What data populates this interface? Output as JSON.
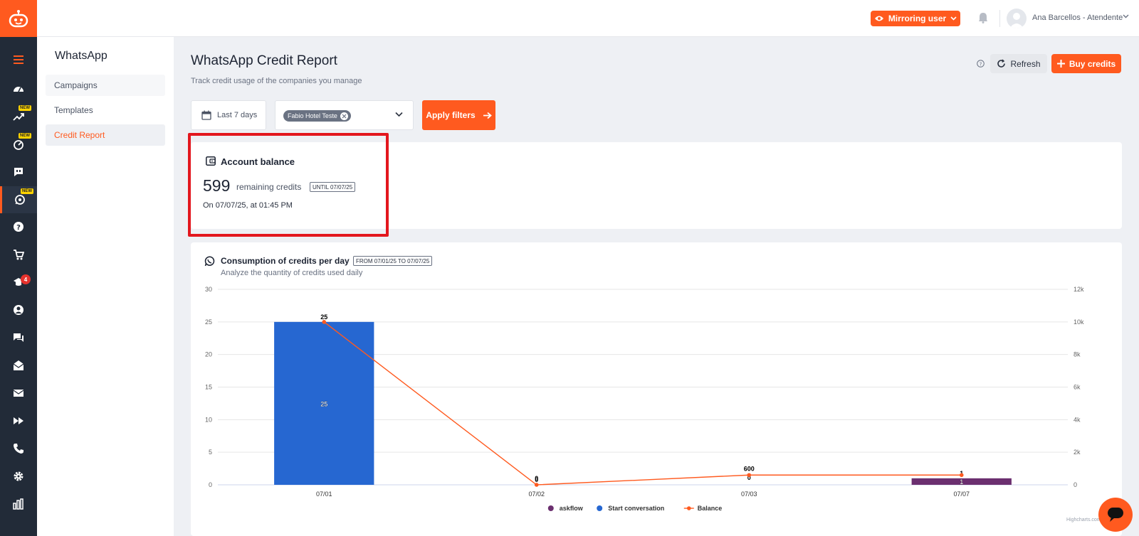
{
  "colors": {
    "accent": "#ff5a1f",
    "rail": "#222b38",
    "highlight": "#e3171e",
    "bar_blue": "#2667d1",
    "bar_purple": "#6b2f6f",
    "balance_line": "#ff5a1f"
  },
  "rail": {
    "icons": [
      "menu-icon",
      "dashboard-icon",
      "trending-icon",
      "rocket-icon",
      "chat-quote-icon",
      "whatsapp-icon",
      "help-icon",
      "cart-icon",
      "graduation-icon",
      "user-circle-icon",
      "chat-icon",
      "mail-open-icon",
      "mail-icon",
      "fast-forward-icon",
      "phone-icon",
      "gear-icon",
      "bar-chart-icon"
    ],
    "new_badge": "NEW",
    "graduation_count": "4"
  },
  "topbar": {
    "mirror_label": "Mirroring user",
    "user_name": "Ana Barcellos - Atendente"
  },
  "sidebar": {
    "title": "WhatsApp",
    "items": [
      {
        "label": "Campaigns"
      },
      {
        "label": "Templates"
      },
      {
        "label": "Credit Report"
      }
    ]
  },
  "main": {
    "title": "WhatsApp Credit Report",
    "subtitle": "Track credit usage of the companies you manage",
    "refresh_label": "Refresh",
    "buy_label": "Buy credits",
    "filters": {
      "date_label": "Last 7 days",
      "company_chip": "Fabio Hotel Teste",
      "apply_label": "Apply filters"
    },
    "balance": {
      "title": "Account balance",
      "value": "599",
      "unit_label": "remaining credits",
      "until_tag": "UNTIL 07/07/25",
      "as_of": "On 07/07/25, at 01:45 PM"
    },
    "chart_card": {
      "title": "Consumption of credits per day",
      "range_tag": "FROM 07/01/25 TO 07/07/25",
      "subtitle": "Analyze the quantity of credits used daily",
      "credits": "Highcharts.com"
    }
  },
  "chart_data": {
    "type": "bar",
    "categories": [
      "07/01",
      "07/02",
      "07/03",
      "07/07"
    ],
    "series": [
      {
        "name": "askflow",
        "type": "bar",
        "axis": "left",
        "color": "#6b2f6f",
        "values": [
          0,
          0,
          0,
          1
        ]
      },
      {
        "name": "Start conversation",
        "type": "bar",
        "axis": "left",
        "color": "#2667d1",
        "values": [
          25,
          0,
          0,
          0
        ]
      },
      {
        "name": "Balance",
        "type": "line",
        "axis": "right",
        "color": "#ff5a1f",
        "values": [
          10000,
          0,
          600,
          600
        ]
      }
    ],
    "stack_totals": [
      "25",
      "0",
      "0",
      "1"
    ],
    "inner_labels": [
      {
        "index": 0,
        "text": "25"
      },
      {
        "index": 3,
        "text": "1"
      }
    ],
    "balance_labels": [
      "",
      "0",
      "600",
      ""
    ],
    "ylim_left": [
      0,
      30
    ],
    "yticks_left": [
      "0",
      "5",
      "10",
      "15",
      "20",
      "25",
      "30"
    ],
    "ylim_right": [
      0,
      12000
    ],
    "yticks_right": [
      "0",
      "2k",
      "4k",
      "6k",
      "8k",
      "10k",
      "12k"
    ],
    "legend": "bottom-center",
    "grid": true
  }
}
